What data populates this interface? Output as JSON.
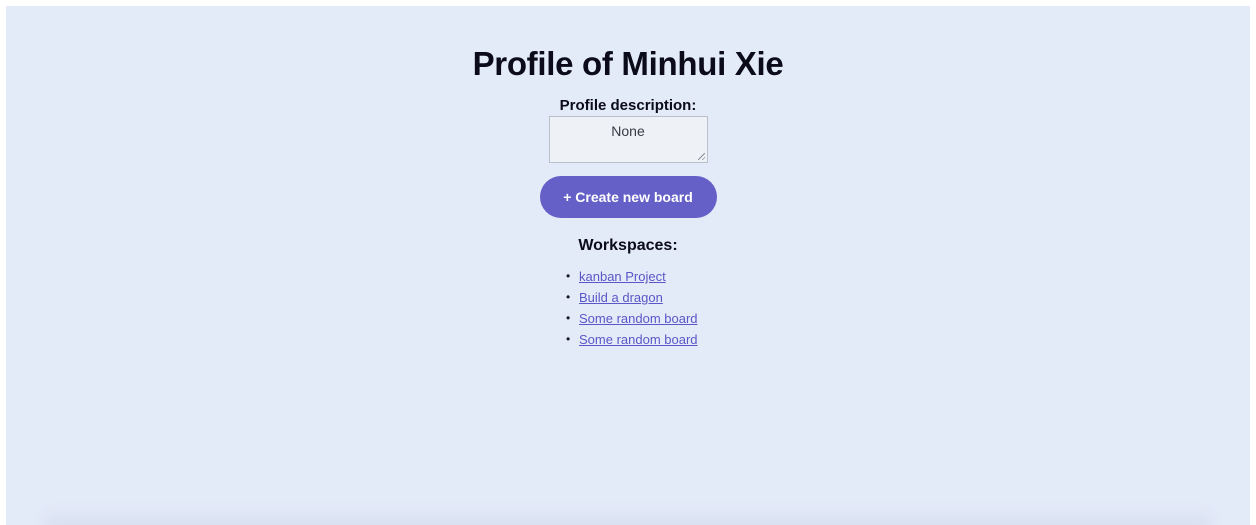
{
  "page": {
    "title": "Profile of Minhui Xie",
    "background": "#e3eaf8"
  },
  "profile": {
    "description_label": "Profile description:",
    "description_value": "None"
  },
  "actions": {
    "create_board_label": "+ Create new board",
    "accent": "#6460c8"
  },
  "workspaces": {
    "heading": "Workspaces:",
    "items": [
      {
        "label": "kanban Project"
      },
      {
        "label": "Build a dragon"
      },
      {
        "label": "Some random board"
      },
      {
        "label": "Some random board"
      }
    ],
    "link_color": "#5a57c8"
  }
}
